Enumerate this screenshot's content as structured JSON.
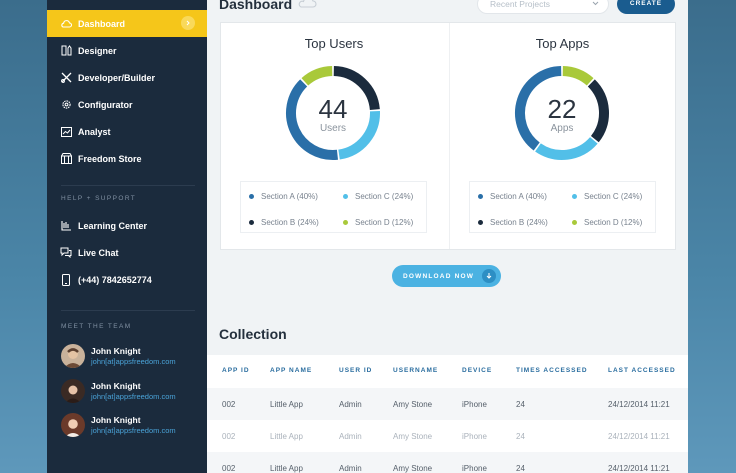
{
  "sidebar": {
    "nav": [
      {
        "label": "Dashboard",
        "icon": "cloud-icon",
        "active": true
      },
      {
        "label": "Designer",
        "icon": "pencil-ruler-icon"
      },
      {
        "label": "Developer/Builder",
        "icon": "tools-icon"
      },
      {
        "label": "Configurator",
        "icon": "gear-icon"
      },
      {
        "label": "Analyst",
        "icon": "chart-icon"
      },
      {
        "label": "Freedom Store",
        "icon": "store-icon"
      }
    ],
    "help_title": "HELP + SUPPORT",
    "help": [
      {
        "label": "Learning Center",
        "icon": "book-icon"
      },
      {
        "label": "Live Chat",
        "icon": "chat-icon"
      },
      {
        "label": "(+44) 7842652774",
        "icon": "phone-icon"
      }
    ],
    "team_title": "MEET THE TEAM",
    "team": [
      {
        "name": "John Knight",
        "email": "john[at]appsfreedom.com"
      },
      {
        "name": "John Knight",
        "email": "john[at]appsfreedom.com"
      },
      {
        "name": "John Knight",
        "email": "john[at]appsfreedom.com"
      }
    ]
  },
  "header": {
    "title": "Dashboard",
    "select_placeholder": "Recent Projects",
    "create_label": "CREATE"
  },
  "colors": {
    "accent_yellow": "#f5c61a",
    "dark_navy": "#1b2b3d",
    "section_a": "#2a6fa8",
    "section_b": "#1b2b3d",
    "section_c": "#52bfe8",
    "section_d": "#a9c93a"
  },
  "chart_data": [
    {
      "type": "pie",
      "title": "Top Users",
      "center_value": "44",
      "center_label": "Users",
      "series": [
        {
          "name": "Section A (40%)",
          "value": 40
        },
        {
          "name": "Section B (24%)",
          "value": 24
        },
        {
          "name": "Section C (24%)",
          "value": 24
        },
        {
          "name": "Section D (12%)",
          "value": 12
        }
      ]
    },
    {
      "type": "pie",
      "title": "Top Apps",
      "center_value": "22",
      "center_label": "Apps",
      "series": [
        {
          "name": "Section A (40%)",
          "value": 40
        },
        {
          "name": "Section B (24%)",
          "value": 24
        },
        {
          "name": "Section C (24%)",
          "value": 24
        },
        {
          "name": "Section D (12%)",
          "value": 12
        }
      ]
    }
  ],
  "download_label": "DOWNLOAD NOW",
  "collection": {
    "title": "Collection",
    "columns": [
      "APP ID",
      "APP NAME",
      "USER ID",
      "USERNAME",
      "DEVICE",
      "TIMES ACCESSED",
      "LAST ACCESSED"
    ],
    "rows": [
      [
        "002",
        "Little App",
        "Admin",
        "Amy Stone",
        "iPhone",
        "24",
        "24/12/2014 11:21"
      ],
      [
        "002",
        "Little App",
        "Admin",
        "Amy Stone",
        "iPhone",
        "24",
        "24/12/2014 11:21"
      ],
      [
        "002",
        "Little App",
        "Admin",
        "Amy Stone",
        "iPhone",
        "24",
        "24/12/2014 11:21"
      ]
    ]
  }
}
